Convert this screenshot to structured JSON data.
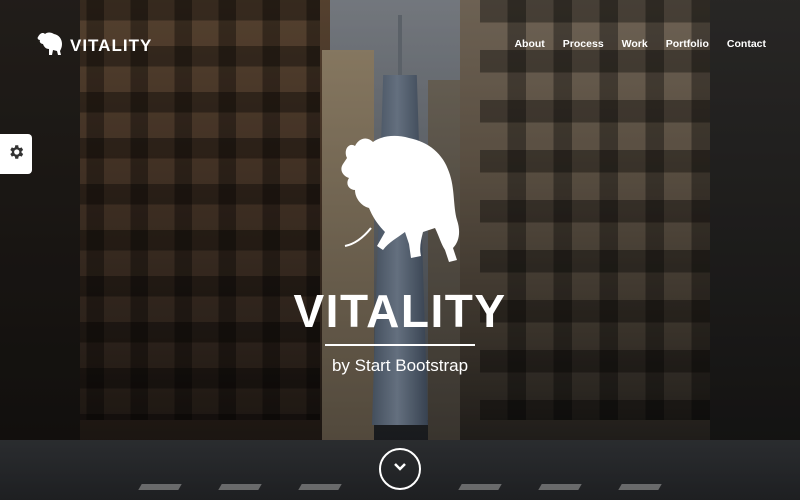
{
  "nav": {
    "brand": "VITALITY",
    "brand_icon": "bull-logo-icon",
    "items": [
      "About",
      "Process",
      "Work",
      "Portfolio",
      "Contact"
    ]
  },
  "settings": {
    "icon": "gear-icon"
  },
  "hero": {
    "title": "VITALITY",
    "subtitle": "by Start Bootstrap",
    "logo_icon": "bull-icon",
    "scroll_icon": "chevron-down-icon"
  },
  "colors": {
    "text": "#ffffff",
    "settings_bg": "#ffffff"
  }
}
